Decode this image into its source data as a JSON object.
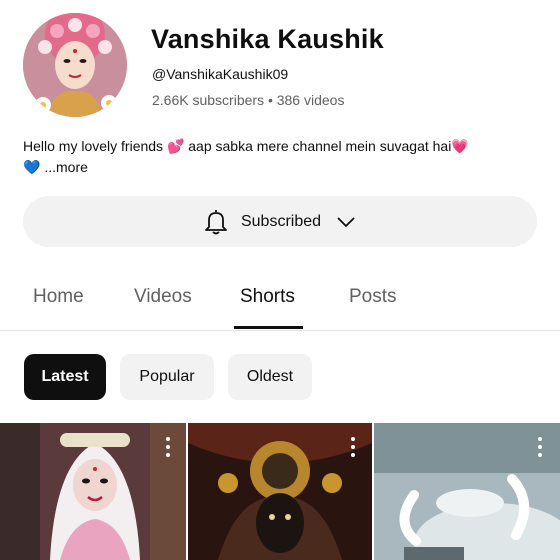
{
  "channel": {
    "name": "Vanshika Kaushik",
    "handle": "@VanshikaKaushik09",
    "stats": "2.66K subscribers • 386 videos",
    "description": "Hello my lovely friends 💕 aap sabka  mere channel mein suvagat  hai💗",
    "description_line2": "💙",
    "more_label": "...more"
  },
  "subscribe": {
    "label": "Subscribed",
    "icon": "bell-icon"
  },
  "tabs": [
    {
      "label": "Home"
    },
    {
      "label": "Videos"
    },
    {
      "label": "Shorts",
      "active": true
    },
    {
      "label": "Posts"
    }
  ],
  "filters": [
    {
      "label": "Latest",
      "active": true
    },
    {
      "label": "Popular"
    },
    {
      "label": "Oldest"
    }
  ]
}
